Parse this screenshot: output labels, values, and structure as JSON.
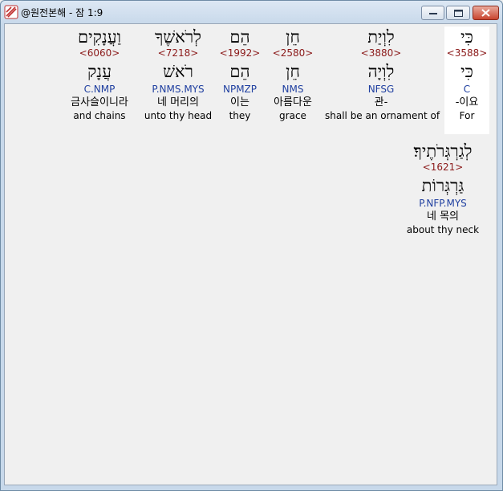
{
  "window": {
    "title": "@원전본해 - 잠 1:9"
  },
  "words": [
    {
      "hebrew": "כִּי",
      "strong": "<3588>",
      "lemma": "כִּי",
      "morph": "C",
      "korean": "-이요",
      "english": "For"
    },
    {
      "hebrew": "לִוְיַת",
      "strong": "<3880>",
      "lemma": "לִוְיָה",
      "morph": "NFSG",
      "korean": "관-",
      "english": "shall be an ornament of"
    },
    {
      "hebrew": "חֵן",
      "strong": "<2580>",
      "lemma": "חֵן",
      "morph": "NMS",
      "korean": "아름다운",
      "english": "grace"
    },
    {
      "hebrew": "הֵם",
      "strong": "<1992>",
      "lemma": "הֵם",
      "morph": "NPMZP",
      "korean": "이는",
      "english": "they"
    },
    {
      "hebrew": "לְרֹאשֶׁךָ",
      "strong": "<7218>",
      "lemma": "רֹאשׁ",
      "morph": "P.NMS.MYS",
      "korean": "네 머리의",
      "english": "unto thy head"
    },
    {
      "hebrew": "וַעֲנָקִים",
      "strong": "<6060>",
      "lemma": "עֲנָק",
      "morph": "C.NMP",
      "korean": "금사슬이니라",
      "english": "and chains"
    },
    {
      "hebrew": "לְגַרְגְּרֹתֶיךָ׃",
      "strong": "<1621>",
      "lemma": "גַּרְגְּרוֹת",
      "morph": "P.NFP.MYS",
      "korean": "네 목의",
      "english": "about thy neck"
    }
  ]
}
